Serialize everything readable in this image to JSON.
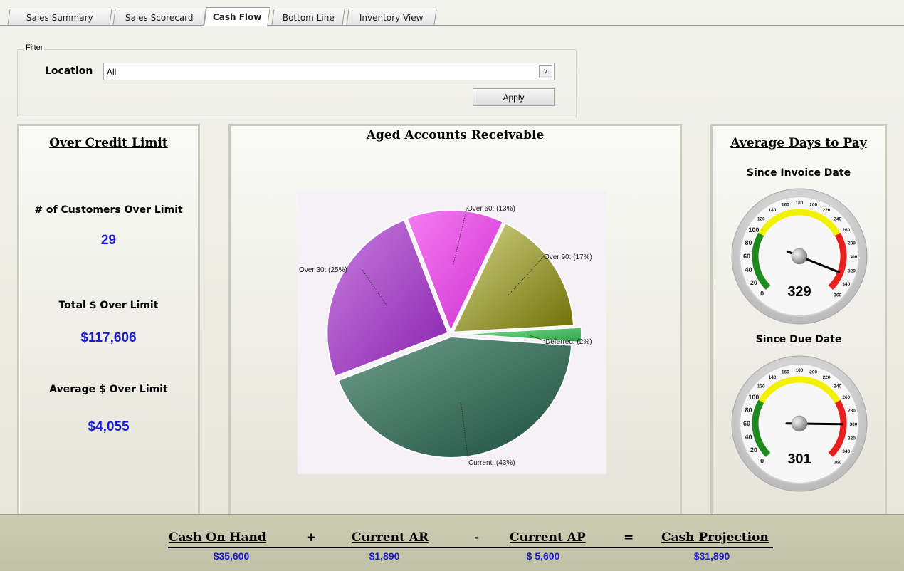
{
  "tabs": [
    {
      "label": "Sales Summary",
      "active": false
    },
    {
      "label": "Sales Scorecard",
      "active": false
    },
    {
      "label": "Cash Flow",
      "active": true
    },
    {
      "label": "Bottom Line",
      "active": false
    },
    {
      "label": "Inventory View",
      "active": false
    }
  ],
  "filter": {
    "legend": "Filter",
    "location_label": "Location",
    "location_value": "All",
    "apply_label": "Apply"
  },
  "credit": {
    "title": "Over Credit Limit",
    "customers_label": "# of Customers Over Limit",
    "customers_value": "29",
    "total_label": "Total $ Over Limit",
    "total_value": "$117,606",
    "average_label": "Average $ Over Limit",
    "average_value": "$4,055"
  },
  "aged": {
    "title": "Aged Accounts Receivable"
  },
  "chart_data": {
    "type": "pie",
    "title": "Aged Accounts Receivable",
    "slices": [
      {
        "label": "Current: (43%)",
        "value": 43,
        "color": "#2f6b57"
      },
      {
        "label": "Over 30: (25%)",
        "value": 25,
        "color": "#a244c6"
      },
      {
        "label": "Over 60: (13%)",
        "value": 13,
        "color": "#e04fe0"
      },
      {
        "label": "Over 90: (17%)",
        "value": 17,
        "color": "#a6a64a"
      },
      {
        "label": "Deferred: (2%)",
        "value": 2,
        "color": "#3fbf5f"
      }
    ]
  },
  "days": {
    "title": "Average Days to Pay",
    "invoice_label": "Since Invoice Date",
    "invoice_value": "329",
    "due_label": "Since Due Date",
    "due_value": "301",
    "gauge_min": 0,
    "gauge_max": 360,
    "green_max": 100,
    "yellow_max": 260,
    "tick_labels": [
      "0",
      "20",
      "40",
      "60",
      "80",
      "100",
      "120",
      "140",
      "160",
      "180",
      "200",
      "220",
      "240",
      "260",
      "280",
      "300",
      "320",
      "340",
      "360"
    ]
  },
  "summary": {
    "cash_label": "Cash On Hand",
    "cash_value": "$35,600",
    "plus": "+",
    "ar_label": "Current AR",
    "ar_value": "$1,890",
    "minus": "-",
    "ap_label": "Current AP",
    "ap_value": "$ 5,600",
    "equals": "=",
    "proj_label": "Cash Projection",
    "proj_value": "$31,890"
  },
  "colors": {
    "value_blue": "#1a1acc",
    "gauge_green": "#1e8a1e",
    "gauge_yellow": "#f2f200",
    "gauge_red": "#e82020"
  }
}
